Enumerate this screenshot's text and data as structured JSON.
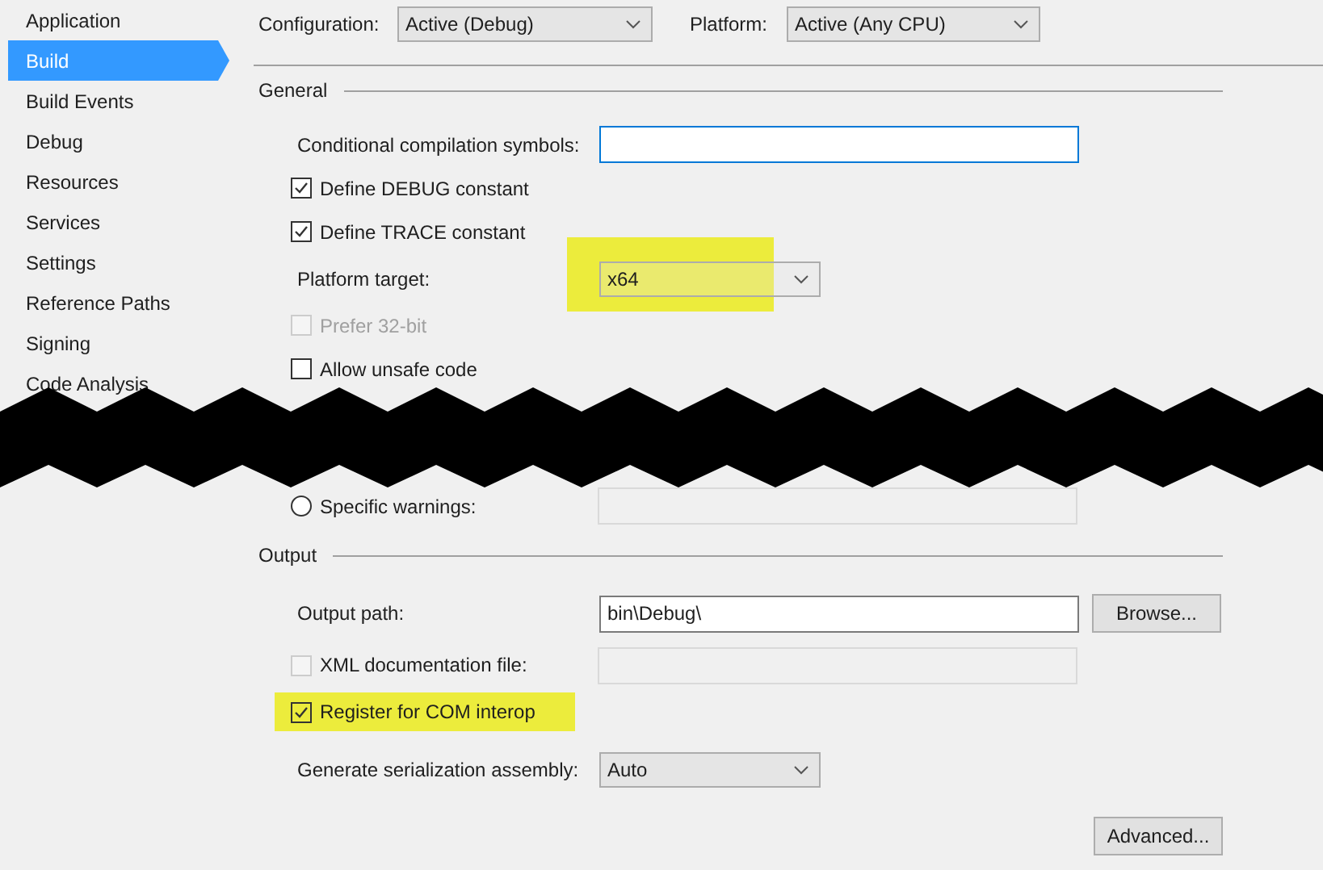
{
  "sidebar": {
    "items": [
      {
        "label": "Application",
        "selected": false
      },
      {
        "label": "Build",
        "selected": true
      },
      {
        "label": "Build Events",
        "selected": false
      },
      {
        "label": "Debug",
        "selected": false
      },
      {
        "label": "Resources",
        "selected": false
      },
      {
        "label": "Services",
        "selected": false
      },
      {
        "label": "Settings",
        "selected": false
      },
      {
        "label": "Reference Paths",
        "selected": false
      },
      {
        "label": "Signing",
        "selected": false
      },
      {
        "label": "Code Analysis",
        "selected": false
      }
    ]
  },
  "toolbar": {
    "configuration": {
      "label": "Configuration:",
      "value": "Active (Debug)"
    },
    "platform": {
      "label": "Platform:",
      "value": "Active (Any CPU)"
    }
  },
  "general": {
    "title": "General",
    "rows": [
      {
        "kind": "field",
        "label": "Conditional compilation symbols:",
        "disabled": false,
        "highlighted": false
      },
      {
        "kind": "checkbox",
        "label": "Define DEBUG constant",
        "checked": true,
        "disabled": false,
        "highlighted": false
      },
      {
        "kind": "checkbox",
        "label": "Define TRACE constant",
        "checked": true,
        "disabled": false,
        "highlighted": false
      },
      {
        "kind": "select",
        "label": "Platform target:",
        "value": "x64",
        "highlighted": true
      },
      {
        "kind": "checkbox",
        "label": "Prefer 32-bit",
        "checked": false,
        "disabled": true,
        "highlighted": false
      },
      {
        "kind": "checkbox",
        "label": "Allow unsafe code",
        "checked": false,
        "disabled": false,
        "highlighted": false
      },
      {
        "kind": "redaction"
      },
      {
        "kind": "radio",
        "label": "Specific warnings:",
        "selected": false,
        "highlighted": false
      }
    ]
  },
  "output": {
    "title": "Output",
    "rows": [
      {
        "kind": "field",
        "label": "Output path:",
        "value": "bin\\Debug\\",
        "disabled": false,
        "button": "Browse...",
        "highlighted": false
      },
      {
        "kind": "checkfield",
        "label": "XML documentation file:",
        "checked": false,
        "disabled": true,
        "highlighted": false
      },
      {
        "kind": "checkbox",
        "label": "Register for COM interop",
        "checked": true,
        "disabled": false,
        "highlighted": true
      },
      {
        "kind": "select",
        "label": "Generate serialization assembly:",
        "value": "Auto",
        "highlighted": false
      }
    ],
    "advanced_button": "Advanced..."
  }
}
